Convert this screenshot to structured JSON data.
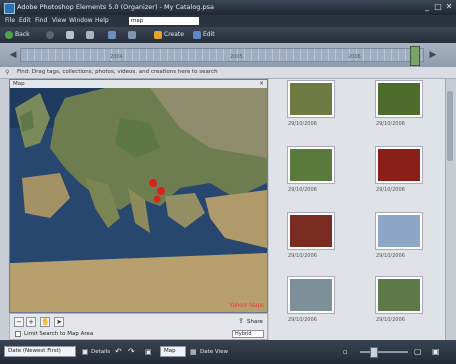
{
  "window": {
    "title": "Adobe Photoshop Elements 5.0 (Organizer) - My Catalog.psa",
    "controls": [
      "_",
      "□",
      "✕"
    ]
  },
  "menu": {
    "items": [
      "File",
      "Edit",
      "Find",
      "View",
      "Window",
      "Help"
    ],
    "search_value": "map"
  },
  "toolbar": {
    "back_label": "Back",
    "create_label": "Create",
    "edit_label": "Edit"
  },
  "timeline": {
    "years": [
      "2004",
      "2005",
      "2006"
    ]
  },
  "find_bar": {
    "text": "Find: Drag tags, collections, photos, videos, and creations here to search"
  },
  "map": {
    "header": "Map",
    "close": "×",
    "brand": "Yahoo! Maps",
    "markers": 3
  },
  "map_controls": {
    "limit_label": "Limit Search to Map Area",
    "share_label": "Share",
    "view_mode": "Hybrid"
  },
  "photos": [
    {
      "date": "29/10/2006",
      "color": "#6f7a42"
    },
    {
      "date": "29/10/2006",
      "color": "#4d6b2a"
    },
    {
      "date": "29/10/2006",
      "color": "#5a7a3c"
    },
    {
      "date": "29/10/2006",
      "color": "#8a1f1a"
    },
    {
      "date": "29/10/2006",
      "color": "#7b2c22"
    },
    {
      "date": "29/10/2006",
      "color": "#8fa7c7"
    },
    {
      "date": "29/10/2006",
      "color": "#7d8f98"
    },
    {
      "date": "29/10/2006",
      "color": "#5f7a4a"
    }
  ],
  "status": {
    "sort_label": "Date (Newest First)",
    "details_label": "Details",
    "map_label": "Map",
    "date_view_label": "Date View"
  },
  "colors": {
    "accent": "#2d6fb3",
    "marker": "#d8231f"
  }
}
